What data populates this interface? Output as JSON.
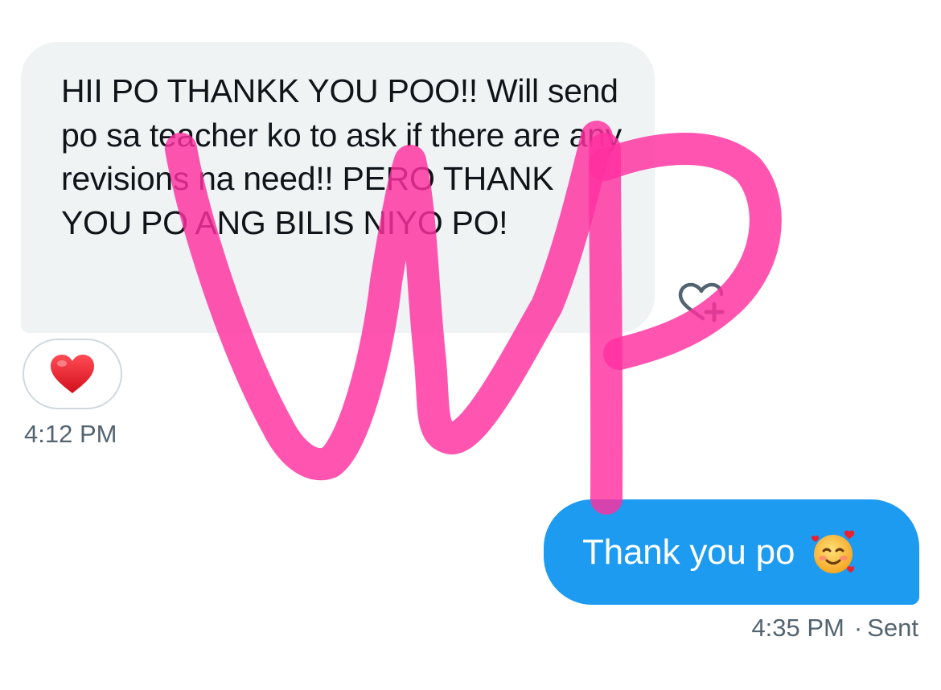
{
  "conversation": {
    "received_message": {
      "text": "HII PO THANKK YOU POO!! Will send po sa teacher ko to ask if there are any revisions na need!! PERO THANK YOU PO ANG BILIS NIYO PO!",
      "reaction_icon": "red-heart-emoji",
      "react_button_icon": "heart-plus-icon",
      "timestamp": "4:12 PM"
    },
    "sent_message": {
      "text": "Thank you po",
      "emoji_icon": "smiling-face-with-hearts-emoji",
      "timestamp": "4:35 PM",
      "status": "Sent"
    }
  },
  "watermark": {
    "text": "WP",
    "color": "#ff2fa0"
  },
  "colors": {
    "received_bubble": "#eff3f4",
    "sent_bubble": "#1d9bf0",
    "meta_text": "#536471",
    "heart": "#e0202b"
  }
}
